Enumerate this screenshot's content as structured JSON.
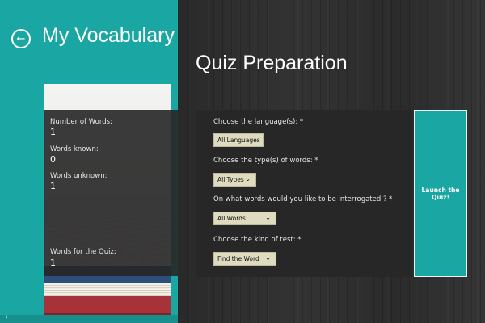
{
  "app": {
    "title": "My Vocabulary"
  },
  "page": {
    "title": "Quiz Preparation"
  },
  "stats": {
    "number_of_words_label": "Number of Words:",
    "number_of_words": "1",
    "words_known_label": "Words known:",
    "words_known": "0",
    "words_unknown_label": "Words unknown:",
    "words_unknown": "1",
    "words_for_quiz_label": "Words for the Quiz:",
    "words_for_quiz": "1"
  },
  "form": {
    "language_label": "Choose the language(s): *",
    "language_value": "All Languages",
    "type_label": "Choose the type(s) of words: *",
    "type_value": "All Types",
    "interrogate_label": "On what words would you like to be interrogated ? *",
    "interrogate_value": "All Words",
    "test_label": "Choose the kind of test: *",
    "test_value": "Find the Word"
  },
  "launch": {
    "label": "Launch the Quiz!"
  },
  "icons": {
    "back": "back-arrow-icon",
    "chevron": "chevron-down-icon",
    "scroll": "chevron-left-icon"
  },
  "colors": {
    "accent": "#1aa6a3",
    "dropdown": "#dedbbf",
    "panel": "#272727"
  }
}
